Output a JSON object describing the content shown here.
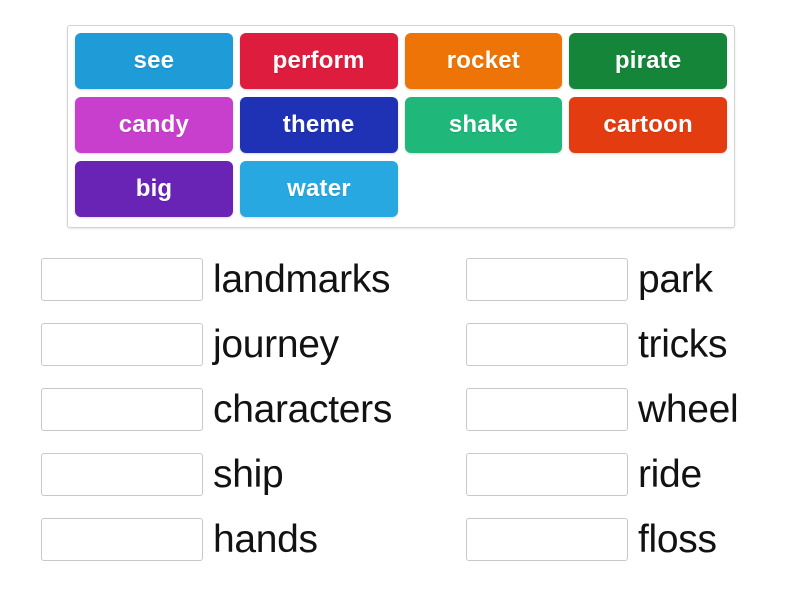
{
  "activity": {
    "type": "match-up-drag-and-drop",
    "tile_text_color": "#ffffff"
  },
  "tile_bank": {
    "rows": [
      [
        {
          "label": "see",
          "color": "#1f9bd8"
        },
        {
          "label": "perform",
          "color": "#dd1c3e"
        },
        {
          "label": "rocket",
          "color": "#ee7407"
        },
        {
          "label": "pirate",
          "color": "#15853a"
        }
      ],
      [
        {
          "label": "candy",
          "color": "#c83fce"
        },
        {
          "label": "theme",
          "color": "#1f32b5"
        },
        {
          "label": "shake",
          "color": "#1fb87a"
        },
        {
          "label": "cartoon",
          "color": "#e23c10"
        }
      ],
      [
        {
          "label": "big",
          "color": "#6a24b5"
        },
        {
          "label": "water",
          "color": "#27a8e0"
        }
      ]
    ]
  },
  "answers": {
    "left_column": [
      {
        "label": "landmarks",
        "drop_value": ""
      },
      {
        "label": "journey",
        "drop_value": ""
      },
      {
        "label": "characters",
        "drop_value": ""
      },
      {
        "label": "ship",
        "drop_value": ""
      },
      {
        "label": "hands",
        "drop_value": ""
      }
    ],
    "right_column": [
      {
        "label": "park",
        "drop_value": ""
      },
      {
        "label": "tricks",
        "drop_value": ""
      },
      {
        "label": "wheel",
        "drop_value": ""
      },
      {
        "label": "ride",
        "drop_value": ""
      },
      {
        "label": "floss",
        "drop_value": ""
      }
    ]
  }
}
